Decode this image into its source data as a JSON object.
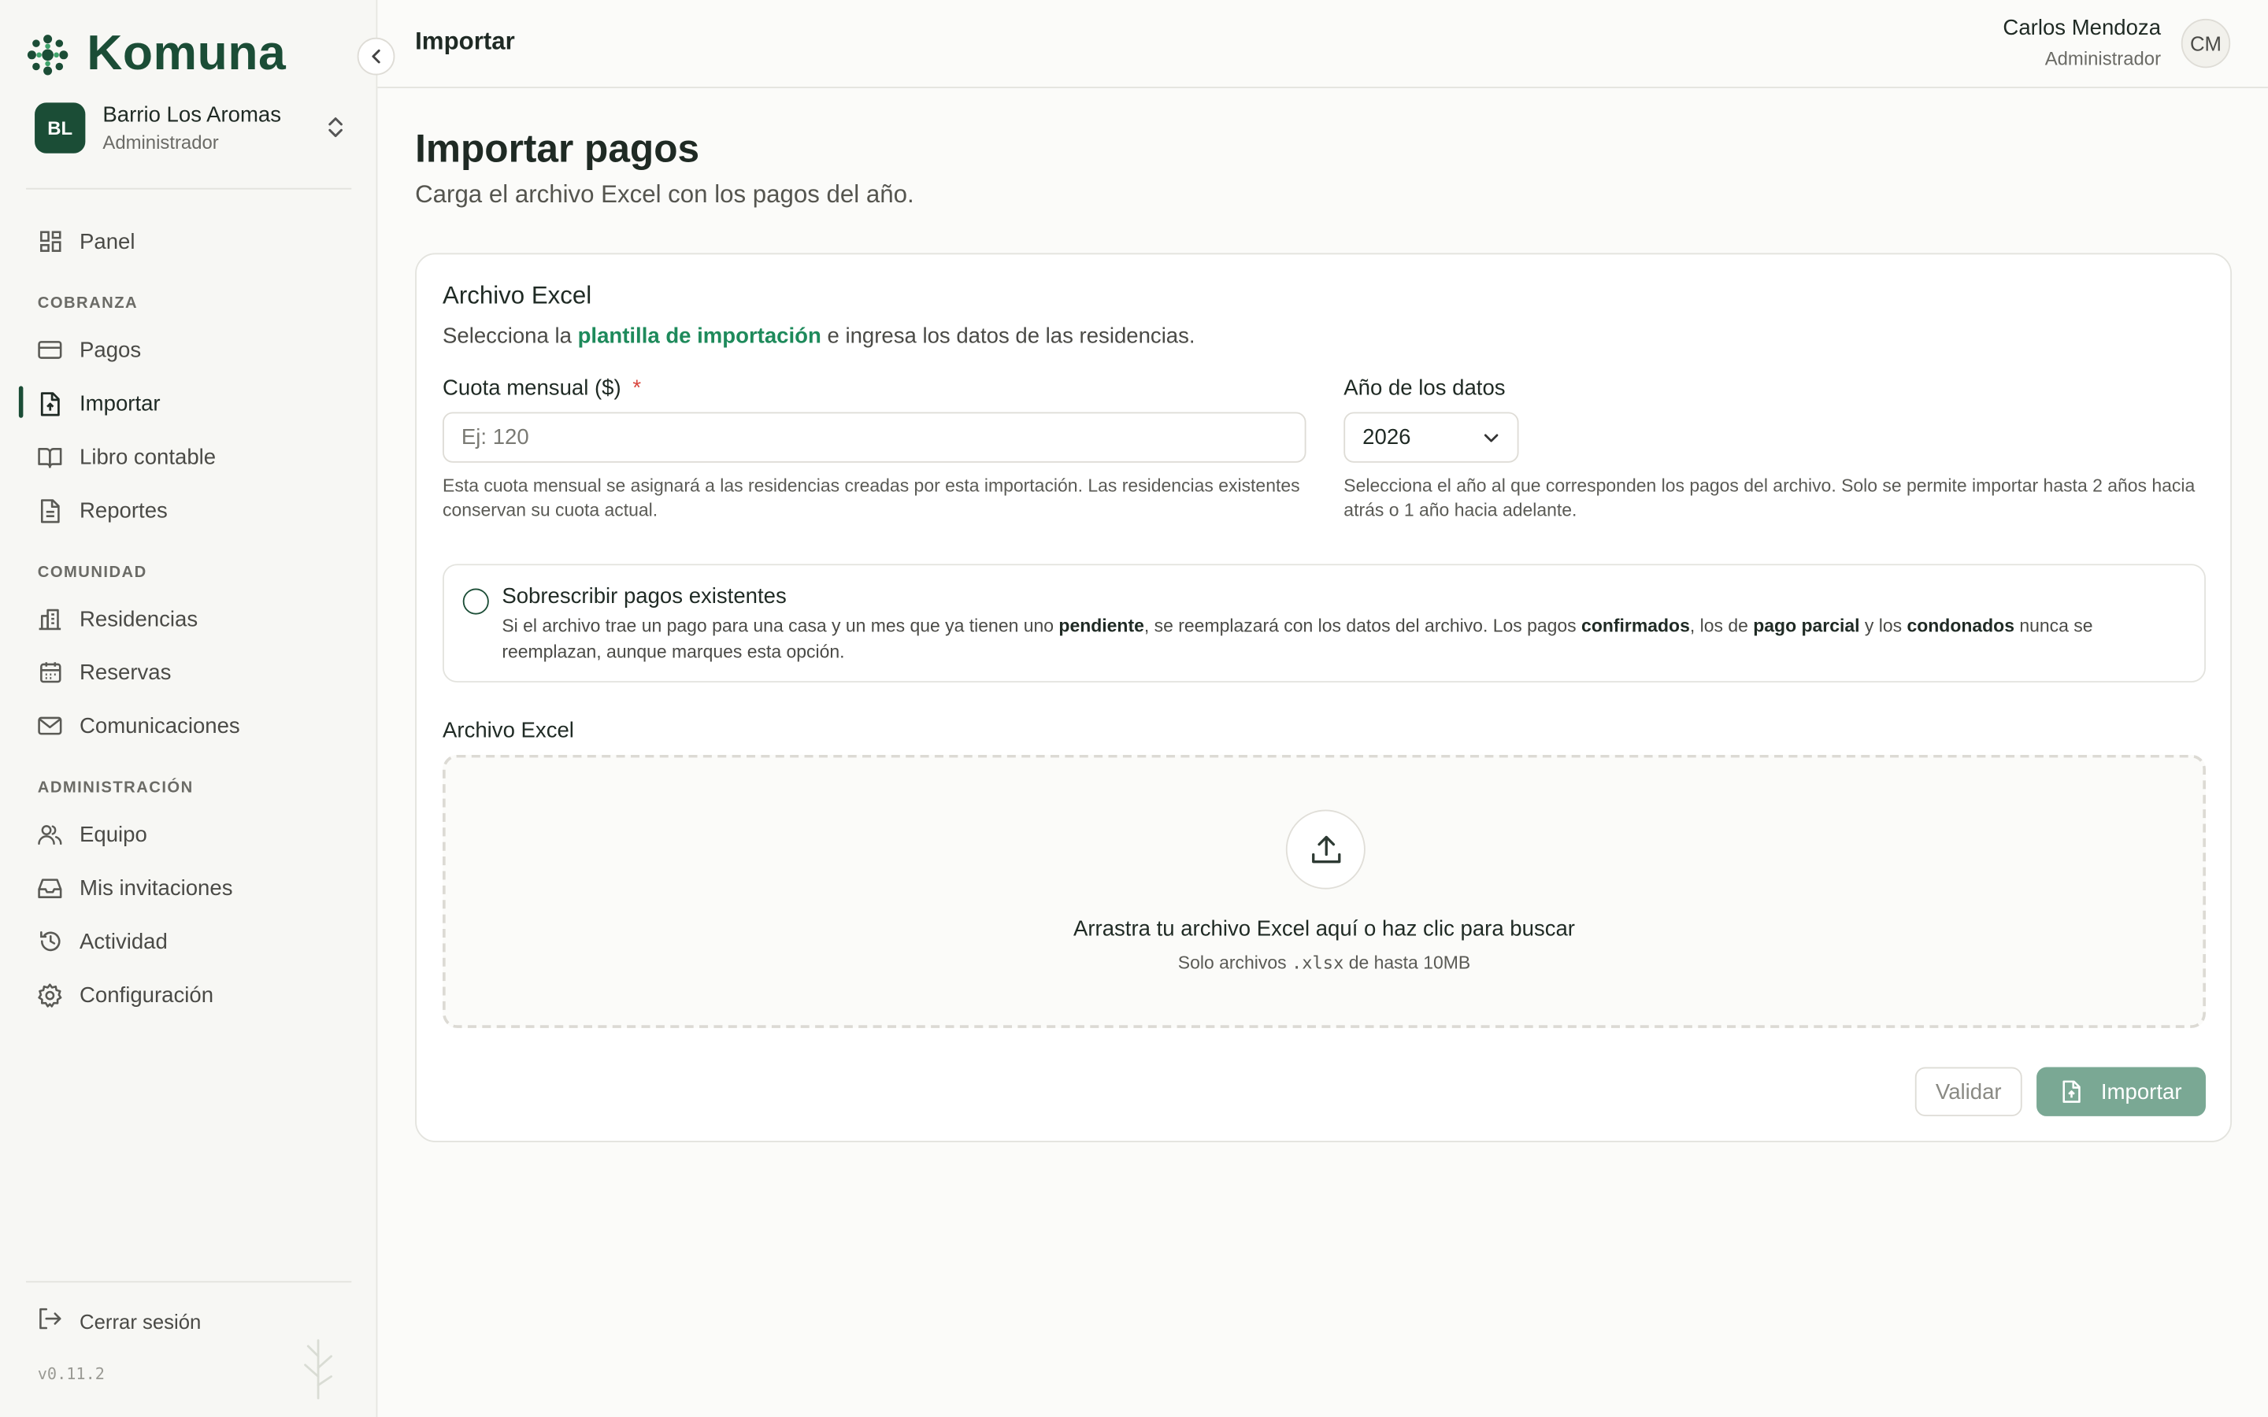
{
  "brand": {
    "name": "Komuna"
  },
  "org": {
    "initials": "BL",
    "name": "Barrio Los Aromas",
    "role": "Administrador"
  },
  "nav": {
    "panel": "Panel",
    "section_cobranza": "COBRANZA",
    "pagos": "Pagos",
    "importar": "Importar",
    "libro": "Libro contable",
    "reportes": "Reportes",
    "section_comunidad": "COMUNIDAD",
    "residencias": "Residencias",
    "reservas": "Reservas",
    "comunicaciones": "Comunicaciones",
    "section_admin": "ADMINISTRACIÓN",
    "equipo": "Equipo",
    "invitaciones": "Mis invitaciones",
    "actividad": "Actividad",
    "configuracion": "Configuración",
    "logout": "Cerrar sesión",
    "version": "v0.11.2"
  },
  "header": {
    "title": "Importar",
    "user_name": "Carlos Mendoza",
    "user_role": "Administrador",
    "user_initials": "CM"
  },
  "page": {
    "title": "Importar pagos",
    "subtitle": "Carga el archivo Excel con los pagos del año."
  },
  "card": {
    "title": "Archivo Excel",
    "desc_pre": "Selecciona la ",
    "desc_link": "plantilla de importación",
    "desc_post": " e ingresa los datos de las residencias.",
    "fee_label": "Cuota mensual ($)",
    "fee_required": "*",
    "fee_placeholder": "Ej: 120",
    "fee_help": "Esta cuota mensual se asignará a las residencias creadas por esta importación. Las residencias existentes conservan su cuota actual.",
    "year_label": "Año de los datos",
    "year_value": "2026",
    "year_help": "Selecciona el año al que corresponden los pagos del archivo. Solo se permite importar hasta 2 años hacia atrás o 1 año hacia adelante.",
    "overwrite_title": "Sobrescribir pagos existentes",
    "ow_1": "Si el archivo trae un pago para una casa y un mes que ya tienen uno ",
    "ow_b1": "pendiente",
    "ow_2": ", se reemplazará con los datos del archivo. Los pagos ",
    "ow_b2": "confirmados",
    "ow_3": ", los de ",
    "ow_b3": "pago parcial",
    "ow_4": " y los ",
    "ow_b4": "condonados",
    "ow_5": " nunca se reemplazan, aunque marques esta opción.",
    "file_label": "Archivo Excel",
    "dz_title": "Arrastra tu archivo Excel aquí o haz clic para buscar",
    "dz_sub_pre": "Solo archivos ",
    "dz_sub_code": ".xlsx",
    "dz_sub_post": " de hasta 10MB",
    "validate_label": "Validar",
    "import_label": "Importar"
  },
  "colors": {
    "brand": "#1b4d36",
    "link": "#1e8a5b",
    "primary_disabled": "#7aa894",
    "required": "#d9463e"
  }
}
